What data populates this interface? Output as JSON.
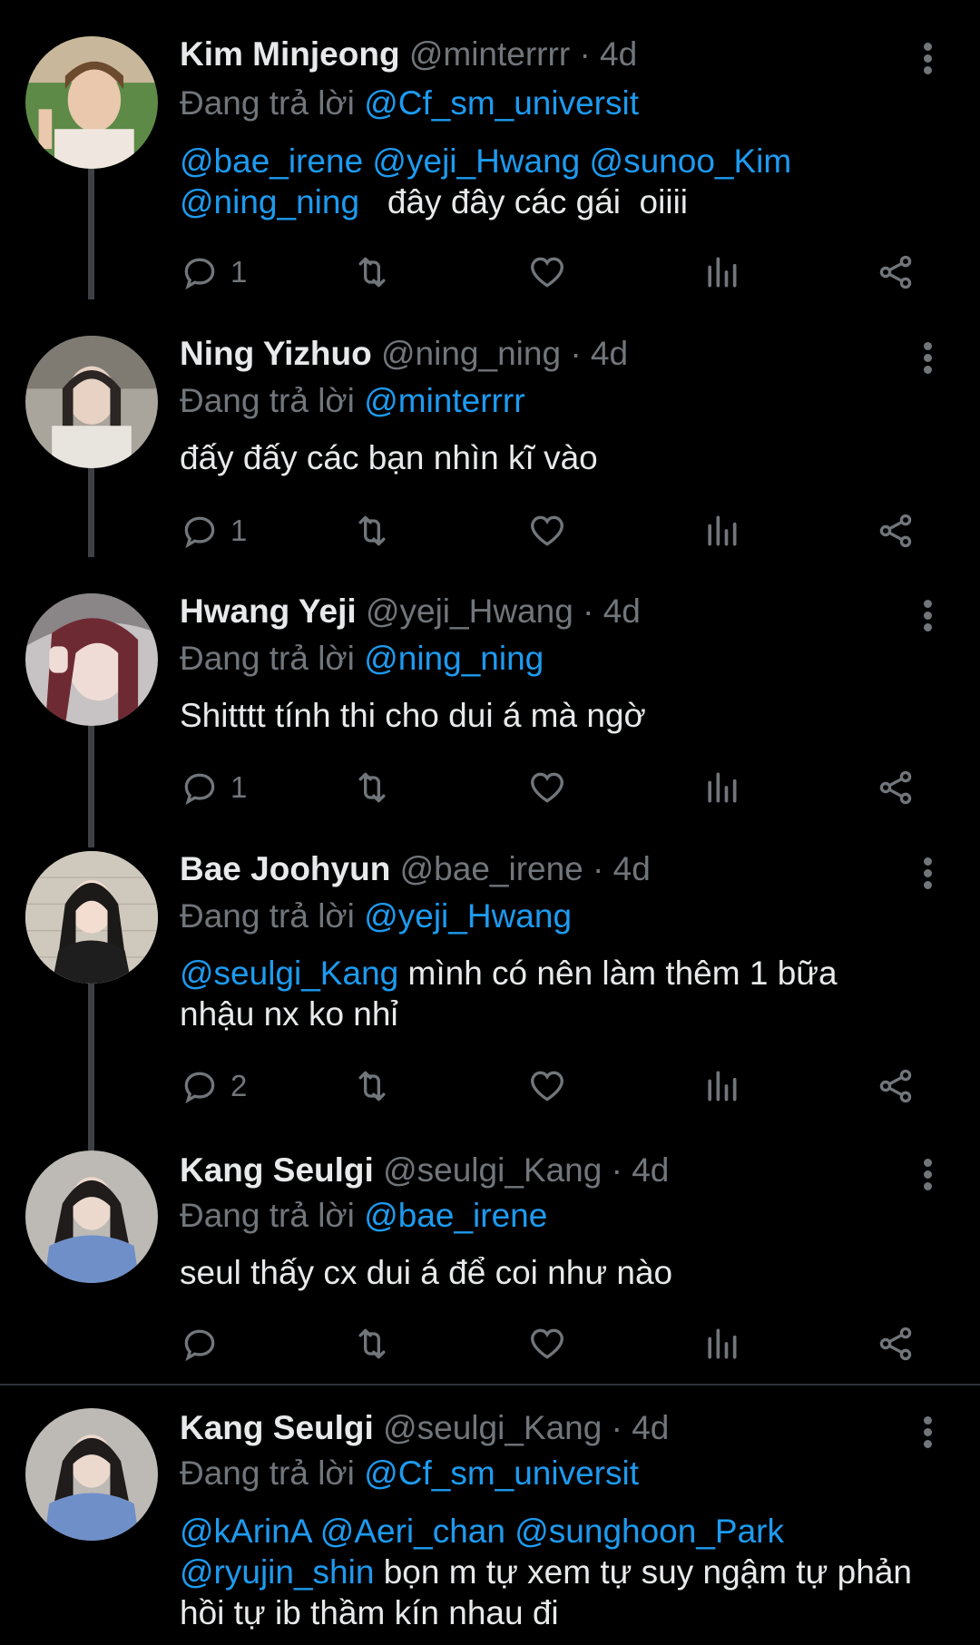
{
  "labels": {
    "replying_prefix": "Đang trả lời"
  },
  "tweets": [
    {
      "name": "Kim Minjeong",
      "handle": "@minterrrr",
      "dot": "·",
      "time": "4d",
      "reply_to": "@Cf_sm_universit",
      "line1_mentions": "@bae_irene @yeji_Hwang @sunoo_Kim",
      "line2_mention": "@ning_ning",
      "line2_text": "   đây đây các gái  oiiii",
      "reply_count": "1"
    },
    {
      "name": "Ning Yizhuo",
      "handle": "@ning_ning",
      "dot": "·",
      "time": "4d",
      "reply_to": "@minterrrr",
      "text": "đấy đấy các bạn nhìn kĩ vào",
      "reply_count": "1"
    },
    {
      "name": "Hwang Yeji",
      "handle": "@yeji_Hwang",
      "dot": "·",
      "time": "4d",
      "reply_to": "@ning_ning",
      "text": "Shitttt tính thi cho dui á mà ngờ",
      "reply_count": "1"
    },
    {
      "name": "Bae Joohyun",
      "handle": "@bae_irene",
      "dot": "·",
      "time": "4d",
      "reply_to": "@yeji_Hwang",
      "mention": "@seulgi_Kang",
      "text": " mình có nên làm thêm 1 bữa",
      "text2": "nhậu nx ko nhỉ",
      "reply_count": "2"
    },
    {
      "name": "Kang Seulgi",
      "handle": "@seulgi_Kang",
      "dot": "·",
      "time": "4d",
      "reply_to": "@bae_irene",
      "text": "seul thấy cx dui á để coi như nào",
      "reply_count": ""
    },
    {
      "name": "Kang Seulgi",
      "handle": "@seulgi_Kang",
      "dot": "·",
      "time": "4d",
      "reply_to": "@Cf_sm_universit",
      "line1_mentions": "@kArinA @Aeri_chan @sunghoon_Park",
      "line2_mention": "@ryujin_shin",
      "line2_text": " bọn m tự xem tự suy ngậm tự phản",
      "line3_text": "hồi tự ib thầm kín nhau đi"
    }
  ]
}
